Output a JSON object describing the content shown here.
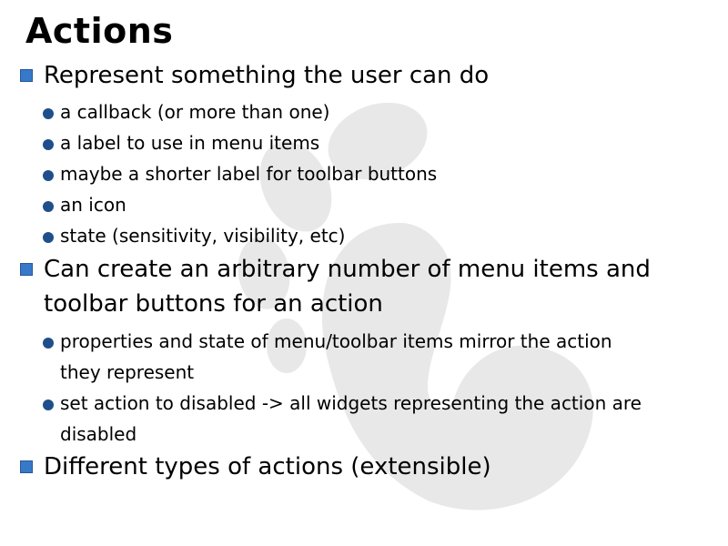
{
  "slide": {
    "title": "Actions",
    "bullets": [
      {
        "text": "Represent something the user can do",
        "sub": [
          "a callback (or more than one)",
          "a label to use in menu items",
          "maybe a shorter label for toolbar buttons",
          "an icon",
          "state (sensitivity, visibility, etc)"
        ]
      },
      {
        "text": "Can create an arbitrary number of menu items and toolbar buttons for an action",
        "sub": [
          "properties and state of menu/toolbar items mirror the action they represent",
          "set action to disabled -> all widgets representing the action are disabled"
        ]
      },
      {
        "text": "Different types of actions (extensible)",
        "sub": []
      }
    ]
  },
  "colors": {
    "bullet_primary": "#3778c9",
    "bullet_secondary": "#1f4f8a",
    "watermark": "#e8e8e8"
  },
  "icons": {
    "watermark": "gnome-foot-icon",
    "level1_bullet": "square-bullet-icon",
    "level2_bullet": "round-bullet-icon"
  }
}
